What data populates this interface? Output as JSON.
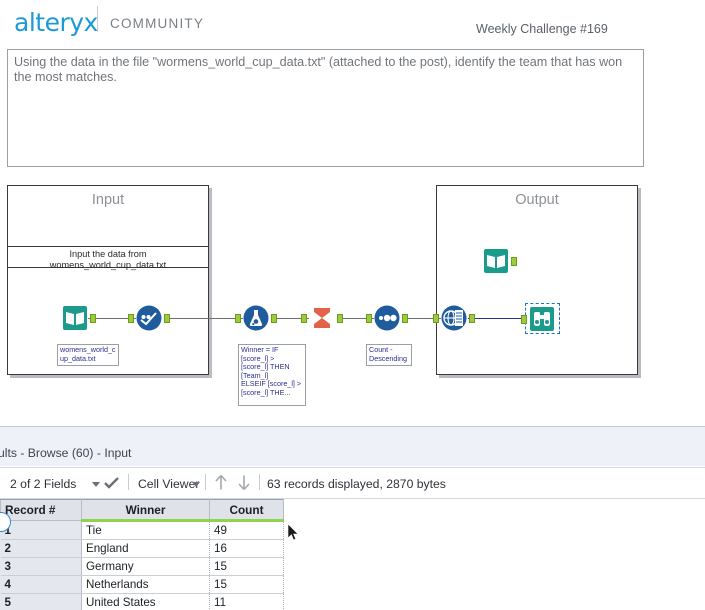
{
  "header": {
    "logo": "alteryx",
    "section": "COMMUNITY",
    "challenge": "Weekly Challenge #169"
  },
  "description": {
    "text": "Using the data in the file \"wormens_world_cup_data.txt\" (attached to the post), identify the team that has won the most matches."
  },
  "canvas": {
    "containers": [
      {
        "title": "Input",
        "annotation_line1": "Input the data from",
        "annotation_line2": "womens_world_cup_data.txt"
      },
      {
        "title": "Output"
      }
    ],
    "tools": [
      {
        "name": "input-data-tool",
        "icon": "book-icon",
        "label": "womens_world_c\nup_data.txt",
        "label_line1": "womens_world_c",
        "label_line2": "up_data.txt",
        "color": "#1c9a8b"
      },
      {
        "name": "select-tool",
        "icon": "select-icon",
        "label": "",
        "color": "#1f5c9e"
      },
      {
        "name": "formula-tool",
        "icon": "flask-icon",
        "label_line1": "Winner = IF",
        "label_line2": "[score_l] >",
        "label_line3": "[score_l] THEN",
        "label_line4": "[Team_l]",
        "label_line5": "ELSEIF [score_l] >",
        "label_line6": "[score_l] THE...",
        "color": "#1f5c9e"
      },
      {
        "name": "summarize-tool",
        "icon": "sigma-icon",
        "label": "",
        "color": "#e2624a"
      },
      {
        "name": "sort-tool",
        "icon": "dots-icon",
        "label_line1": "Count -",
        "label_line2": "Descending",
        "color": "#1f5c9e"
      },
      {
        "name": "browse-tool-mid",
        "icon": "globe-chart-icon",
        "label": "",
        "color": "#1f5c9e"
      },
      {
        "name": "input-data-tool-output",
        "icon": "book-icon",
        "label": "",
        "color": "#1c9a8b"
      },
      {
        "name": "browse-tool-selected",
        "icon": "binoculars-icon",
        "label": "",
        "color": "#1c9a8b"
      }
    ]
  },
  "results": {
    "title": "ults - Browse (60) - Input",
    "toolbar": {
      "fields": "2 of 2 Fields",
      "viewer": "Cell Viewer",
      "status": "63 records displayed, 2870 bytes",
      "up_arrow": "arrow-up-icon",
      "down_arrow": "arrow-down-icon",
      "check": "check-icon"
    },
    "grid": {
      "columns": [
        "Record #",
        "Winner",
        "Count"
      ],
      "rows": [
        {
          "record": "1",
          "winner": "Tie",
          "count": "49"
        },
        {
          "record": "2",
          "winner": "England",
          "count": "16"
        },
        {
          "record": "3",
          "winner": "Germany",
          "count": "15"
        },
        {
          "record": "4",
          "winner": "Netherlands",
          "count": "15"
        },
        {
          "record": "5",
          "winner": "United States",
          "count": "11"
        }
      ]
    }
  },
  "colors": {
    "brand_blue": "#1c9ad6",
    "tool_blue": "#1f5c9e",
    "tool_teal": "#1c9a8b",
    "tool_orange": "#e2624a",
    "anchor_green": "#9ccb3b",
    "header_green": "#8ed44f"
  }
}
